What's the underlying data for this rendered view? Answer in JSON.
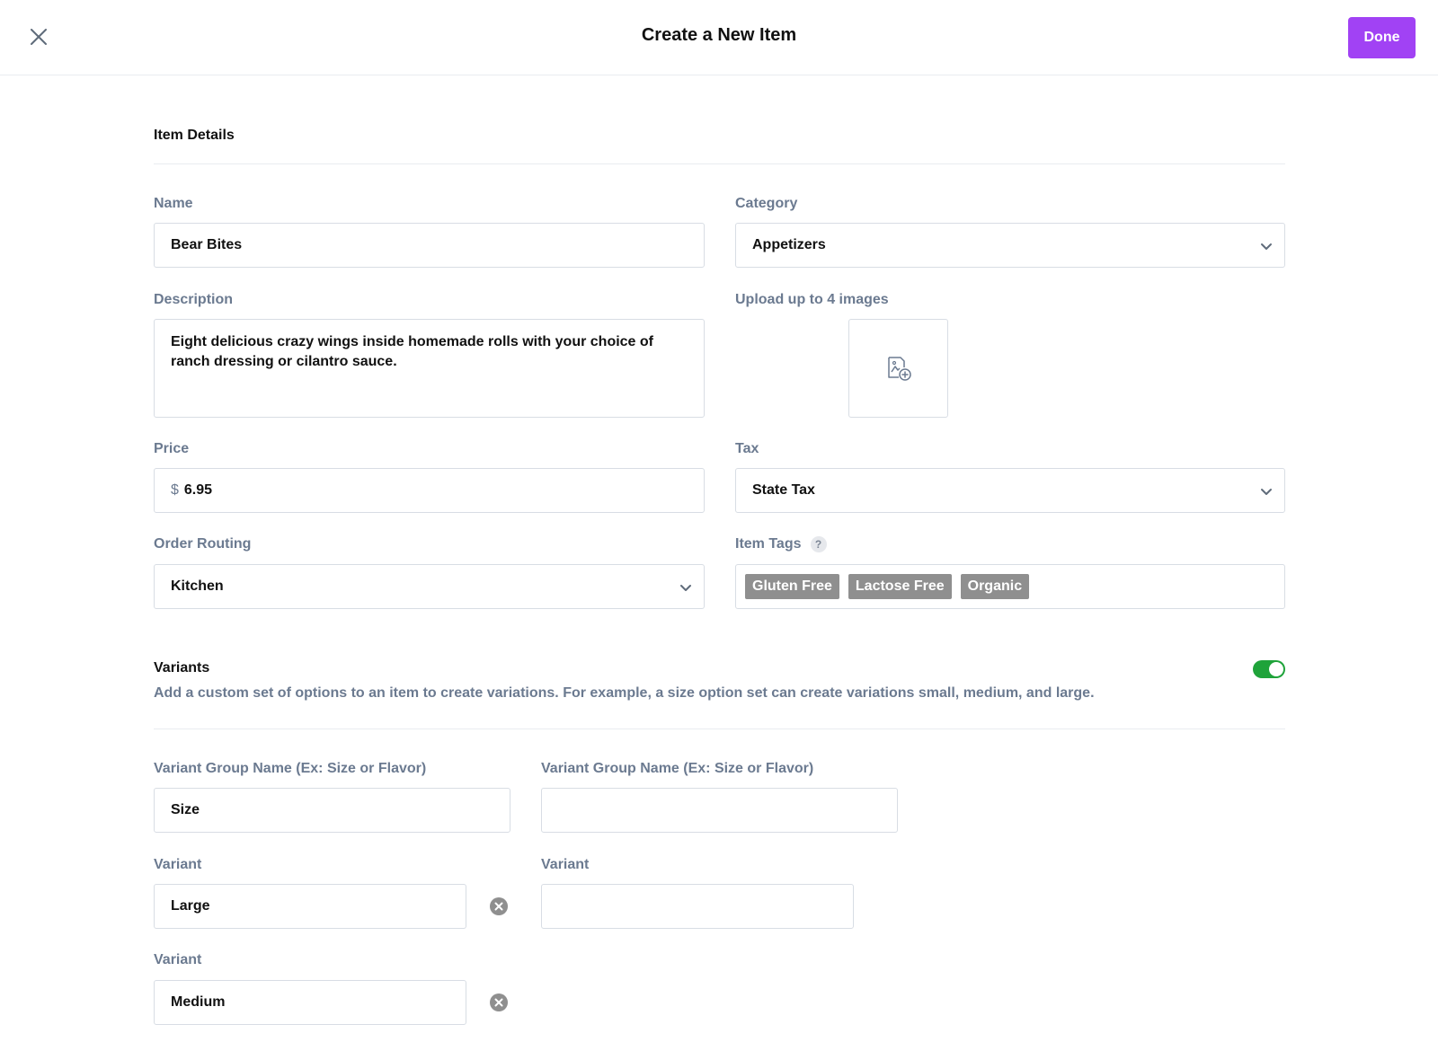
{
  "header": {
    "title": "Create a New Item",
    "done_label": "Done",
    "close_icon": "close-icon"
  },
  "colors": {
    "accent": "#a142f4",
    "toggle_on": "#1fa33a",
    "label": "#6b7a90",
    "tag_bg": "#8f8f8f"
  },
  "item_details": {
    "section_title": "Item Details",
    "name": {
      "label": "Name",
      "value": "Bear Bites"
    },
    "category": {
      "label": "Category",
      "value": "Appetizers"
    },
    "description": {
      "label": "Description",
      "value": "Eight delicious crazy wings inside homemade rolls with your choice of ranch dressing or cilantro sauce."
    },
    "upload": {
      "label": "Upload up to 4 images",
      "icon": "image-add-icon"
    },
    "price": {
      "label": "Price",
      "currency": "$",
      "value": "6.95"
    },
    "tax": {
      "label": "Tax",
      "value": "State Tax"
    },
    "order_routing": {
      "label": "Order Routing",
      "value": "Kitchen"
    },
    "item_tags": {
      "label": "Item Tags",
      "help": "?",
      "tags": [
        "Gluten Free",
        "Lactose Free",
        "Organic"
      ]
    }
  },
  "variants": {
    "title": "Variants",
    "enabled": true,
    "description": "Add a custom set of options to an item to create variations. For example, a size option set can create variations small, medium, and large.",
    "groups": [
      {
        "name_label": "Variant Group Name (Ex: Size or Flavor)",
        "name_value": "Size",
        "variants": [
          {
            "label": "Variant",
            "value": "Large"
          },
          {
            "label": "Variant",
            "value": "Medium"
          }
        ]
      },
      {
        "name_label": "Variant Group Name (Ex: Size or Flavor)",
        "name_value": "",
        "variants": [
          {
            "label": "Variant",
            "value": ""
          }
        ]
      }
    ]
  }
}
